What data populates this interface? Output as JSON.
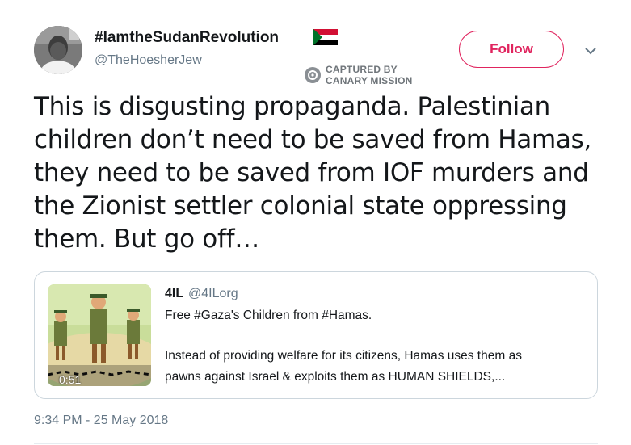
{
  "author": {
    "display_name": "#IamtheSudanRevolution",
    "handle": "@TheHoesherJew",
    "flag_icon": "sudan-flag-icon"
  },
  "watermark": {
    "line1": "CAPTURED BY",
    "line2": "CANARY MISSION"
  },
  "follow_label": "Follow",
  "tweet": {
    "lines": [
      "This is disgusting propaganda. Palestinian",
      "children don’t need to be saved from Hamas,",
      "they need to be saved from IOF murders and",
      "the Zionist settler colonial state oppressing",
      "them. But go off…"
    ]
  },
  "quoted": {
    "name": "4IL",
    "handle": "@4ILorg",
    "line1": "Free #Gaza's Children from #Hamas.",
    "line2": "Instead of providing welfare for its citizens, Hamas uses them as",
    "line3": "pawns against Israel & exploits them as HUMAN SHIELDS,...",
    "video_duration": "0:51"
  },
  "timestamp": "9:34 PM - 25 May 2018",
  "colors": {
    "follow_accent": "#e0245e",
    "secondary_text": "#657786",
    "border": "#ccd6dd"
  }
}
